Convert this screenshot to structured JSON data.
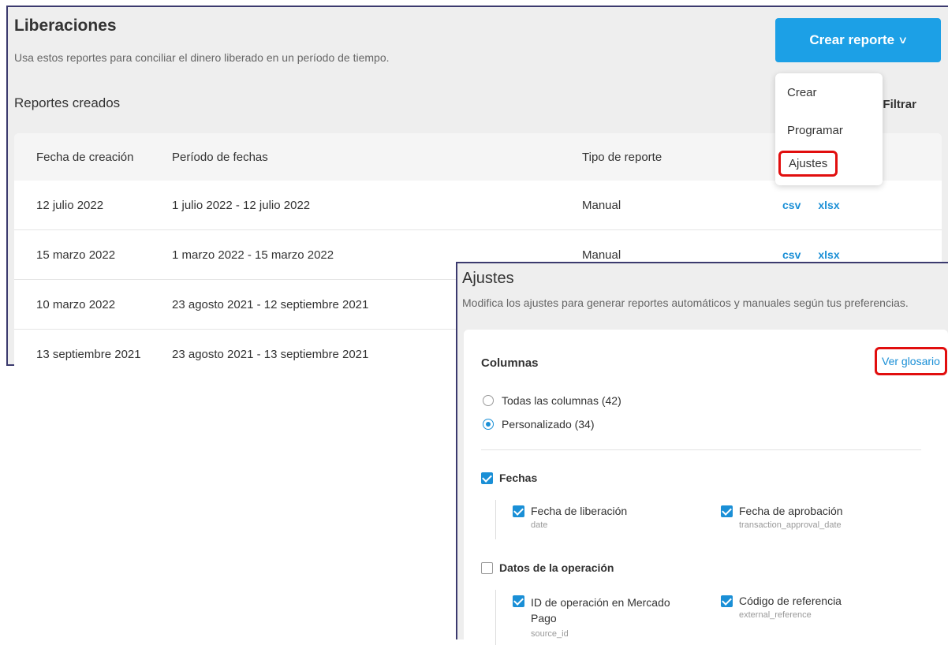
{
  "header": {
    "title": "Liberaciones",
    "subtitle": "Usa estos reportes para conciliar el dinero liberado en un período de tiempo.",
    "create_button": "Crear reporte",
    "reports_title": "Reportes creados",
    "filter_label": "Filtrar"
  },
  "menu": {
    "items": [
      "Crear",
      "Programar",
      "Ajustes"
    ]
  },
  "table": {
    "headers": [
      "Fecha de creación",
      "Período de fechas",
      "Tipo de reporte"
    ],
    "rows": [
      {
        "date": "12 julio 2022",
        "period": "1 julio 2022 - 12 julio 2022",
        "type": "Manual",
        "csv": "csv",
        "xlsx": "xlsx"
      },
      {
        "date": "15 marzo 2022",
        "period": "1 marzo 2022 - 15 marzo 2022",
        "type": "Manual",
        "csv": "csv",
        "xlsx": "xlsx"
      },
      {
        "date": "10 marzo 2022",
        "period": "23 agosto 2021 - 12 septiembre 2021",
        "type": "",
        "csv": "",
        "xlsx": ""
      },
      {
        "date": "13 septiembre 2021",
        "period": "23 agosto 2021 - 13 septiembre 2021",
        "type": "",
        "csv": "",
        "xlsx": ""
      }
    ]
  },
  "settings": {
    "title": "Ajustes",
    "subtitle": "Modifica los ajustes para generar reportes automáticos y manuales según tus preferencias.",
    "columns_title": "Columnas",
    "glossary_link": "Ver glosario",
    "radio_all": "Todas las columnas (42)",
    "radio_custom": "Personalizado (34)",
    "group_dates": "Fechas",
    "release_date_label": "Fecha de liberación",
    "release_date_key": "date",
    "approval_date_label": "Fecha de aprobación",
    "approval_date_key": "transaction_approval_date",
    "group_operation": "Datos de la operación",
    "operation_id_label": "ID de operación en Mercado Pago",
    "operation_id_key": "source_id",
    "reference_label": "Código de referencia",
    "reference_key": "external_reference"
  },
  "colors": {
    "accent": "#1ca0e6",
    "link": "#1a8fd6",
    "highlight": "#e10e0e",
    "frame": "#3b3a6e"
  },
  "icons": {
    "filter": "filter-sort-icon",
    "chevron": "chevron-down-icon"
  }
}
